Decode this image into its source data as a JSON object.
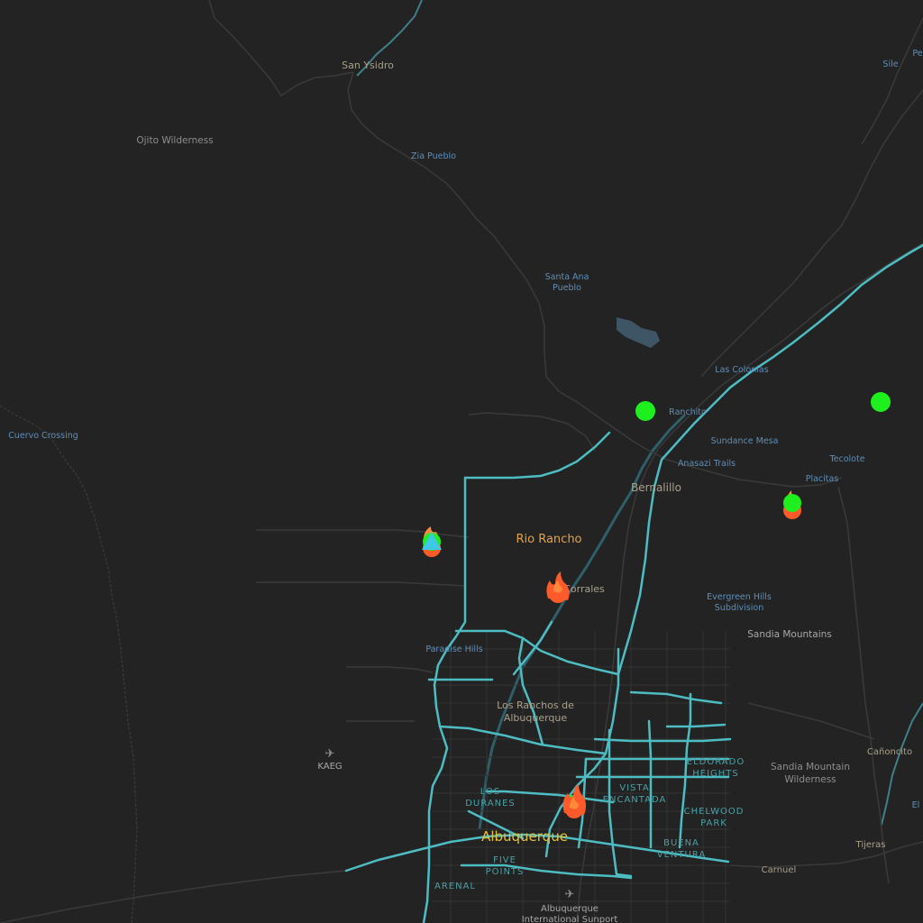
{
  "map": {
    "colors": {
      "background": "#232323",
      "road": "#3a3a3a",
      "highway": "#4dbdc3",
      "water": "#3e5566",
      "terrain_label": "#8e8e8e",
      "locality_label": "#a9a08a",
      "neighborhood_label": "#5d8fba",
      "district_label": "#4aa0a6",
      "city_label": "#e3a248",
      "capital_label": "#e8c13a",
      "marker_green": "#1df01d",
      "marker_fire": "#ff5a2a",
      "marker_fire_inner": "#ff8a3c",
      "marker_triangle": "#3ec8e6"
    },
    "labels": {
      "san_ysidro": "San Ysidro",
      "ojito_wilderness": "Ojito Wilderness",
      "zia_pueblo": "Zia Pueblo",
      "santa_ana_pueblo_1": "Santa Ana",
      "santa_ana_pueblo_2": "Pueblo",
      "cuervo_crossing": "Cuervo Crossing",
      "las_colonias": "Las Colonias",
      "ranchito": "Ranchito",
      "sundance_mesa": "Sundance Mesa",
      "anasazi_trails": "Anasazi Trails",
      "tecolote": "Tecolote",
      "placitas": "Placitas",
      "bernalillo": "Bernalillo",
      "rio_rancho": "Rio Rancho",
      "corrales": "Corrales",
      "evergreen_hills_1": "Evergreen Hills",
      "evergreen_hills_2": "Subdivision",
      "sandia_mountains": "Sandia Mountains",
      "paradise_hills": "Paradise Hills",
      "los_ranchos_1": "Los Ranchos de",
      "los_ranchos_2": "Albuquerque",
      "kaeg": "KAEG",
      "eldorado_1": "ELDORADO",
      "eldorado_2": "HEIGHTS",
      "sandia_wilderness_1": "Sandia Mountain",
      "sandia_wilderness_2": "Wilderness",
      "canoncito": "Cañoncito",
      "los_duranes_1": "LOS",
      "los_duranes_2": "DURANES",
      "vista_encantada_1": "VISTA",
      "vista_encantada_2": "ENCANTADA",
      "chelwood_1": "CHELWOOD",
      "chelwood_2": "PARK",
      "buena_ventura_1": "BUENA",
      "buena_ventura_2": "VENTURA",
      "albuquerque": "Albuquerque",
      "five_points_1": "FIVE",
      "five_points_2": "POINTS",
      "arenal": "ARENAL",
      "tijeras": "Tijeras",
      "carnuel": "Carnuel",
      "airport_1": "Albuquerque",
      "airport_2": "International Sunport",
      "sile": "Sile",
      "pe": "Pe",
      "el": "El"
    },
    "markers": [
      {
        "type": "circle",
        "name": "marker-green-ranchito"
      },
      {
        "type": "circle",
        "name": "marker-green-east"
      },
      {
        "type": "fire",
        "name": "marker-fire-placitas"
      },
      {
        "type": "fire",
        "name": "marker-fire-rio-rancho-west"
      },
      {
        "type": "fire",
        "name": "marker-fire-corrales"
      },
      {
        "type": "fire",
        "name": "marker-fire-albuquerque"
      }
    ]
  }
}
